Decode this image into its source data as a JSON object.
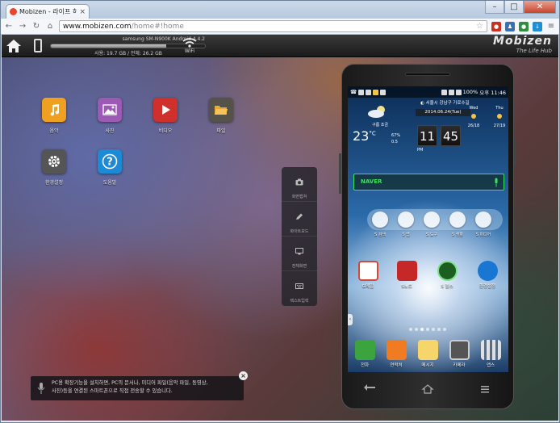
{
  "browser": {
    "tab_title": "Mobizen - 라이프 허브 S",
    "tab_close": "×",
    "window_buttons": [
      "–",
      "□",
      "✕"
    ],
    "url_domain": "www.mobizen.com",
    "url_path": "/home#!home"
  },
  "topbar": {
    "device_name": "samsung SM-N900K Android 4.4.2",
    "storage_text": "사용: 19.7 GB / 전체: 26.2 GB",
    "storage_used_fraction": 0.75,
    "wifi_label": "WiFi",
    "brand": "Mobizen",
    "brand_tagline": "The Life Hub"
  },
  "apps": [
    {
      "label": "음악",
      "icon": "music-icon",
      "color": "#f0a020"
    },
    {
      "label": "사진",
      "icon": "photo-icon",
      "color": "#9c5ab5"
    },
    {
      "label": "비디오",
      "icon": "video-icon",
      "color": "#d0302c"
    },
    {
      "label": "파일",
      "icon": "folder-icon",
      "color": "#55524a"
    },
    {
      "label": "환경설정",
      "icon": "settings-icon",
      "color": "#555555"
    },
    {
      "label": "도움말",
      "icon": "help-icon",
      "color": "#1d8ad6"
    }
  ],
  "side_panel": [
    "화면캡쳐",
    "화이트보드",
    "전체화면",
    "텍스트입력"
  ],
  "tip": {
    "line1": "PC용 확장기능을 설치하면, PC의 문서나, 미디어 파일(음악 파일, 동영상,",
    "line2": "사진)등을 연결된 스마트폰으로 직접 전송할 수 있습니다.",
    "close": "×"
  },
  "phone": {
    "status": {
      "left": "☎",
      "battery": "100%",
      "time": "오후 11:46"
    },
    "weather": {
      "location": "◐ 서울시 강남구 가로수길",
      "date": "2014.06.24(Tue)",
      "temp": "23",
      "unit": "°C",
      "condition": "구름 조금",
      "stats": [
        "67%",
        "0.5"
      ],
      "clock_hour": "11",
      "clock_min": "45",
      "ampm": "PM",
      "forecast_days": [
        "Wed",
        "Thu"
      ],
      "forecast_temps": [
        "26/18",
        "27/19"
      ]
    },
    "search": {
      "label": "NAVER"
    },
    "folders": [
      "S 검색",
      "S 앱",
      "S 도구",
      "S 생활",
      "S 미디어"
    ],
    "apps": [
      "G메일",
      "S노트",
      "S 헬스",
      "환경설정"
    ],
    "dock": [
      "전화",
      "연락처",
      "메시지",
      "카메라",
      "앱스"
    ]
  }
}
